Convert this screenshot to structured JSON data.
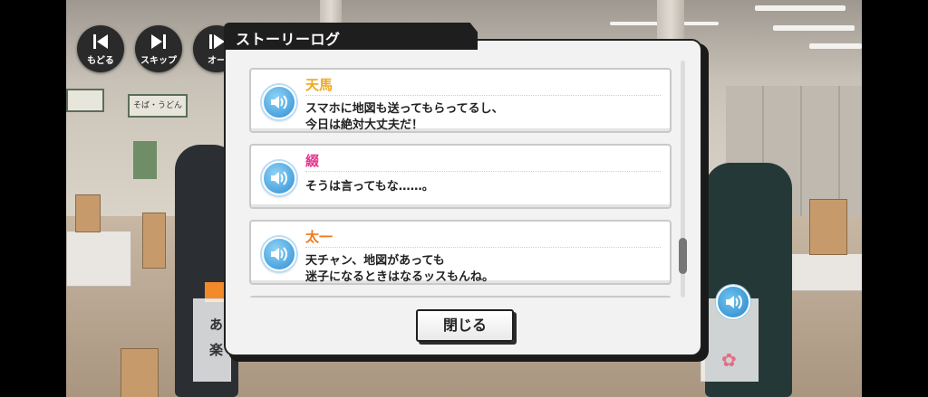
{
  "controls": {
    "back_label": "もどる",
    "skip_label": "スキップ",
    "auto_label": "オー"
  },
  "dialog": {
    "title": "ストーリーログ",
    "close_label": "閉じる"
  },
  "entries": [
    {
      "name": "天馬",
      "name_color": "#f0a81e",
      "lines": [
        "スマホに地図も送ってもらってるし、",
        "今日は絶対大丈夫だ！"
      ]
    },
    {
      "name": "綴",
      "name_color": "#e8358f",
      "lines": [
        "そうは言ってもな……。"
      ]
    },
    {
      "name": "太一",
      "name_color": "#f07a1e",
      "lines": [
        "天チャン、地図があっても",
        "迷子になるときはなるッスもんね。"
      ]
    }
  ],
  "background": {
    "signs": [
      "そば・うどん"
    ],
    "peek_text": [
      "あ",
      "楽"
    ]
  },
  "colors": {
    "dialog_dark": "#1e1e1e",
    "voice_blue": "#2f8fd4"
  },
  "icons": [
    "rewind-icon",
    "skip-icon",
    "auto-play-icon",
    "speaker-icon",
    "flower-icon"
  ]
}
